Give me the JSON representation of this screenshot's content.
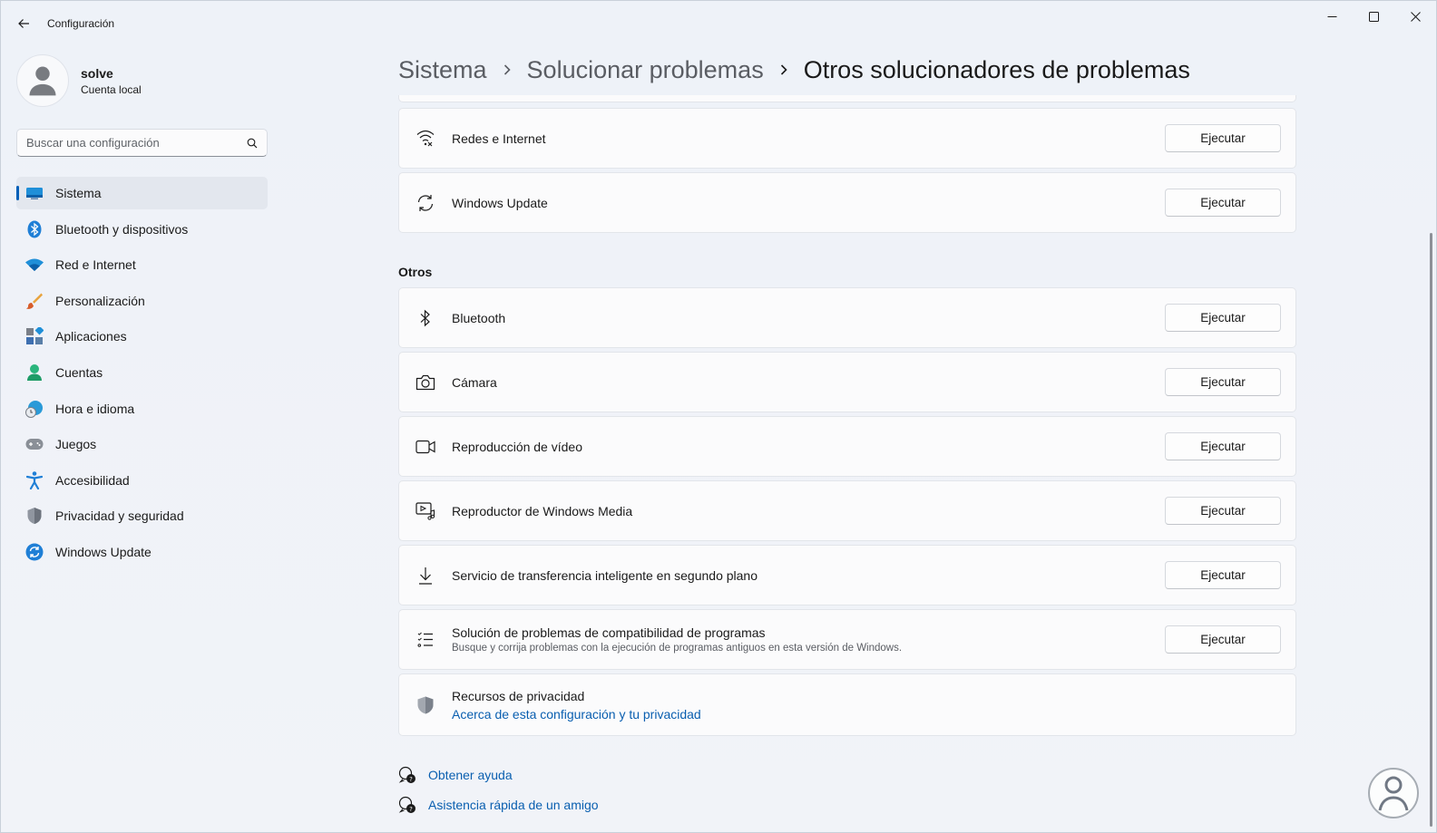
{
  "window": {
    "title": "Configuración"
  },
  "user": {
    "name": "solve",
    "account_type": "Cuenta local"
  },
  "search": {
    "placeholder": "Buscar una configuración"
  },
  "sidebar": {
    "items": [
      {
        "label": "Sistema",
        "icon": "system-monitor-icon",
        "active": true
      },
      {
        "label": "Bluetooth y dispositivos",
        "icon": "bluetooth-icon"
      },
      {
        "label": "Red e Internet",
        "icon": "wifi-icon"
      },
      {
        "label": "Personalización",
        "icon": "paintbrush-icon"
      },
      {
        "label": "Aplicaciones",
        "icon": "apps-icon"
      },
      {
        "label": "Cuentas",
        "icon": "person-icon"
      },
      {
        "label": "Hora e idioma",
        "icon": "clock-globe-icon"
      },
      {
        "label": "Juegos",
        "icon": "gamepad-icon"
      },
      {
        "label": "Accesibilidad",
        "icon": "accessibility-icon"
      },
      {
        "label": "Privacidad y seguridad",
        "icon": "shield-icon"
      },
      {
        "label": "Windows Update",
        "icon": "windows-update-icon"
      }
    ]
  },
  "breadcrumb": {
    "items": [
      "Sistema",
      "Solucionar problemas",
      "Otros solucionadores de problemas"
    ]
  },
  "top_cards": [
    {
      "title": "Redes e Internet",
      "icon": "network-wifi-icon",
      "button": "Ejecutar"
    },
    {
      "title": "Windows Update",
      "icon": "sync-icon",
      "button": "Ejecutar"
    }
  ],
  "section": {
    "title": "Otros"
  },
  "other_cards": [
    {
      "title": "Bluetooth",
      "icon": "bluetooth-outline-icon",
      "button": "Ejecutar"
    },
    {
      "title": "Cámara",
      "icon": "camera-icon",
      "button": "Ejecutar"
    },
    {
      "title": "Reproducción de vídeo",
      "icon": "video-camera-icon",
      "button": "Ejecutar"
    },
    {
      "title": "Reproductor de Windows Media",
      "icon": "media-player-icon",
      "button": "Ejecutar"
    },
    {
      "title": "Servicio de transferencia inteligente en segundo plano",
      "icon": "download-icon",
      "button": "Ejecutar"
    },
    {
      "title": "Solución de problemas de compatibilidad de programas",
      "description": "Busque y corrija problemas con la ejecución de programas antiguos en esta versión de Windows.",
      "icon": "list-icon",
      "button": "Ejecutar"
    }
  ],
  "privacy_card": {
    "title": "Recursos de privacidad",
    "link": "Acerca de esta configuración y tu privacidad",
    "icon": "privacy-shield-icon"
  },
  "help": {
    "get_help": "Obtener ayuda",
    "quick_assist": "Asistencia rápida de un amigo"
  },
  "colors": {
    "accent": "#005fb8",
    "link": "#0a5fb0"
  }
}
